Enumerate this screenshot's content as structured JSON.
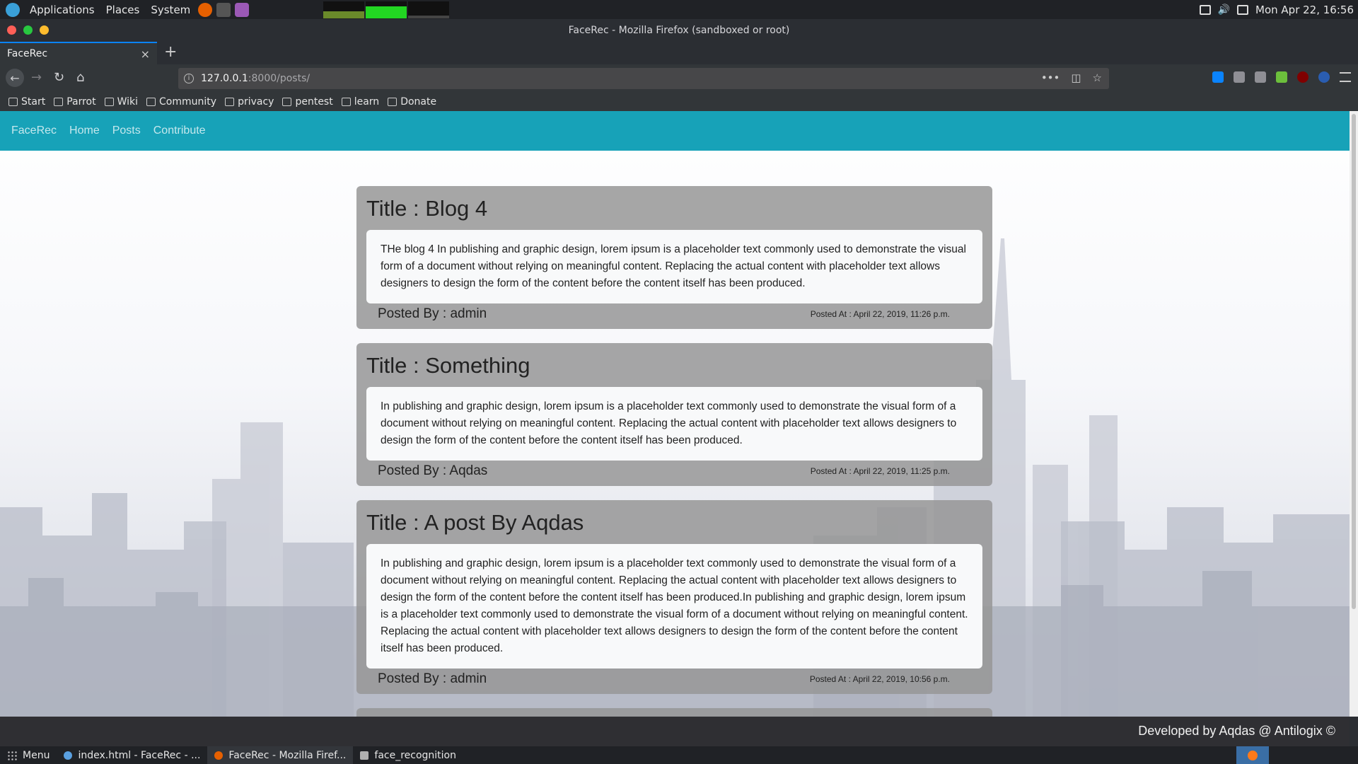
{
  "os_panel": {
    "menus": [
      "Applications",
      "Places",
      "System"
    ],
    "clock": "Mon Apr 22, 16:56"
  },
  "browser": {
    "window_title": "FaceRec - Mozilla Firefox (sandboxed or root)",
    "tab_title": "FaceRec",
    "tab_close": "×",
    "new_tab": "+",
    "url_host": "127.0.0.1",
    "url_rest": ":8000/posts/",
    "bookmarks": [
      "Start",
      "Parrot",
      "Wiki",
      "Community",
      "privacy",
      "pentest",
      "learn",
      "Donate"
    ]
  },
  "site": {
    "brand": "FaceRec",
    "nav": [
      "Home",
      "Posts",
      "Contribute"
    ],
    "posts": [
      {
        "title": "Title : Blog 4",
        "body": "THe blog 4 In publishing and graphic design, lorem ipsum is a placeholder text commonly used to demonstrate the visual form of a document without relying on meaningful content. Replacing the actual content with placeholder text allows designers to design the form of the content before the content itself has been produced.",
        "posted_by": "Posted By : admin",
        "posted_at": "Posted At : April 22, 2019, 11:26 p.m."
      },
      {
        "title": "Title : Something",
        "body": "In publishing and graphic design, lorem ipsum is a placeholder text commonly used to demonstrate the visual form of a document without relying on meaningful content. Replacing the actual content with placeholder text allows designers to design the form of the content before the content itself has been produced.",
        "posted_by": "Posted By : Aqdas",
        "posted_at": "Posted At : April 22, 2019, 11:25 p.m."
      },
      {
        "title": "Title : A post By Aqdas",
        "body": "In publishing and graphic design, lorem ipsum is a placeholder text commonly used to demonstrate the visual form of a document without relying on meaningful content. Replacing the actual content with placeholder text allows designers to design the form of the content before the content itself has been produced.In publishing and graphic design, lorem ipsum is a placeholder text commonly used to demonstrate the visual form of a document without relying on meaningful content. Replacing the actual content with placeholder text allows designers to design the form of the content before the content itself has been produced.",
        "posted_by": "Posted By : admin",
        "posted_at": "Posted At : April 22, 2019, 10:56 p.m."
      }
    ],
    "footer": "Developed by Aqdas @ Antilogix ©"
  },
  "taskbar": {
    "menu": "Menu",
    "tasks": [
      "index.html - FaceRec - ...",
      "FaceRec - Mozilla Firef...",
      "face_recognition"
    ]
  },
  "colors": {
    "navbar": "#17a2b8",
    "card": "#969696",
    "footer": "#2f2f33"
  }
}
